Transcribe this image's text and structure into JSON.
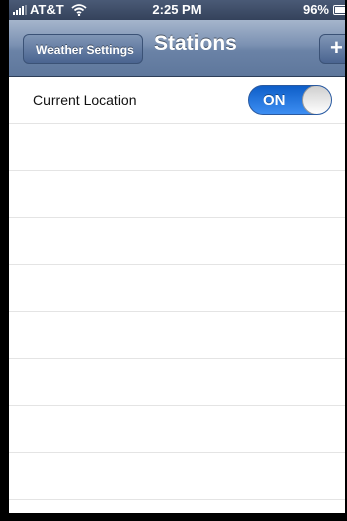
{
  "status_bar": {
    "carrier": "AT&T",
    "time": "2:25 PM",
    "battery": "96%",
    "icons": [
      "signal-icon",
      "wifi-icon",
      "battery-icon"
    ]
  },
  "nav": {
    "back_label": "Weather Settings",
    "title": "Stations",
    "add_label": "+"
  },
  "rows": [
    {
      "label": "Current Location",
      "toggle": "ON",
      "toggle_on": true
    }
  ],
  "colors": {
    "nav_bar": "#6a82a6",
    "toggle_on": "#1f6fdc"
  }
}
